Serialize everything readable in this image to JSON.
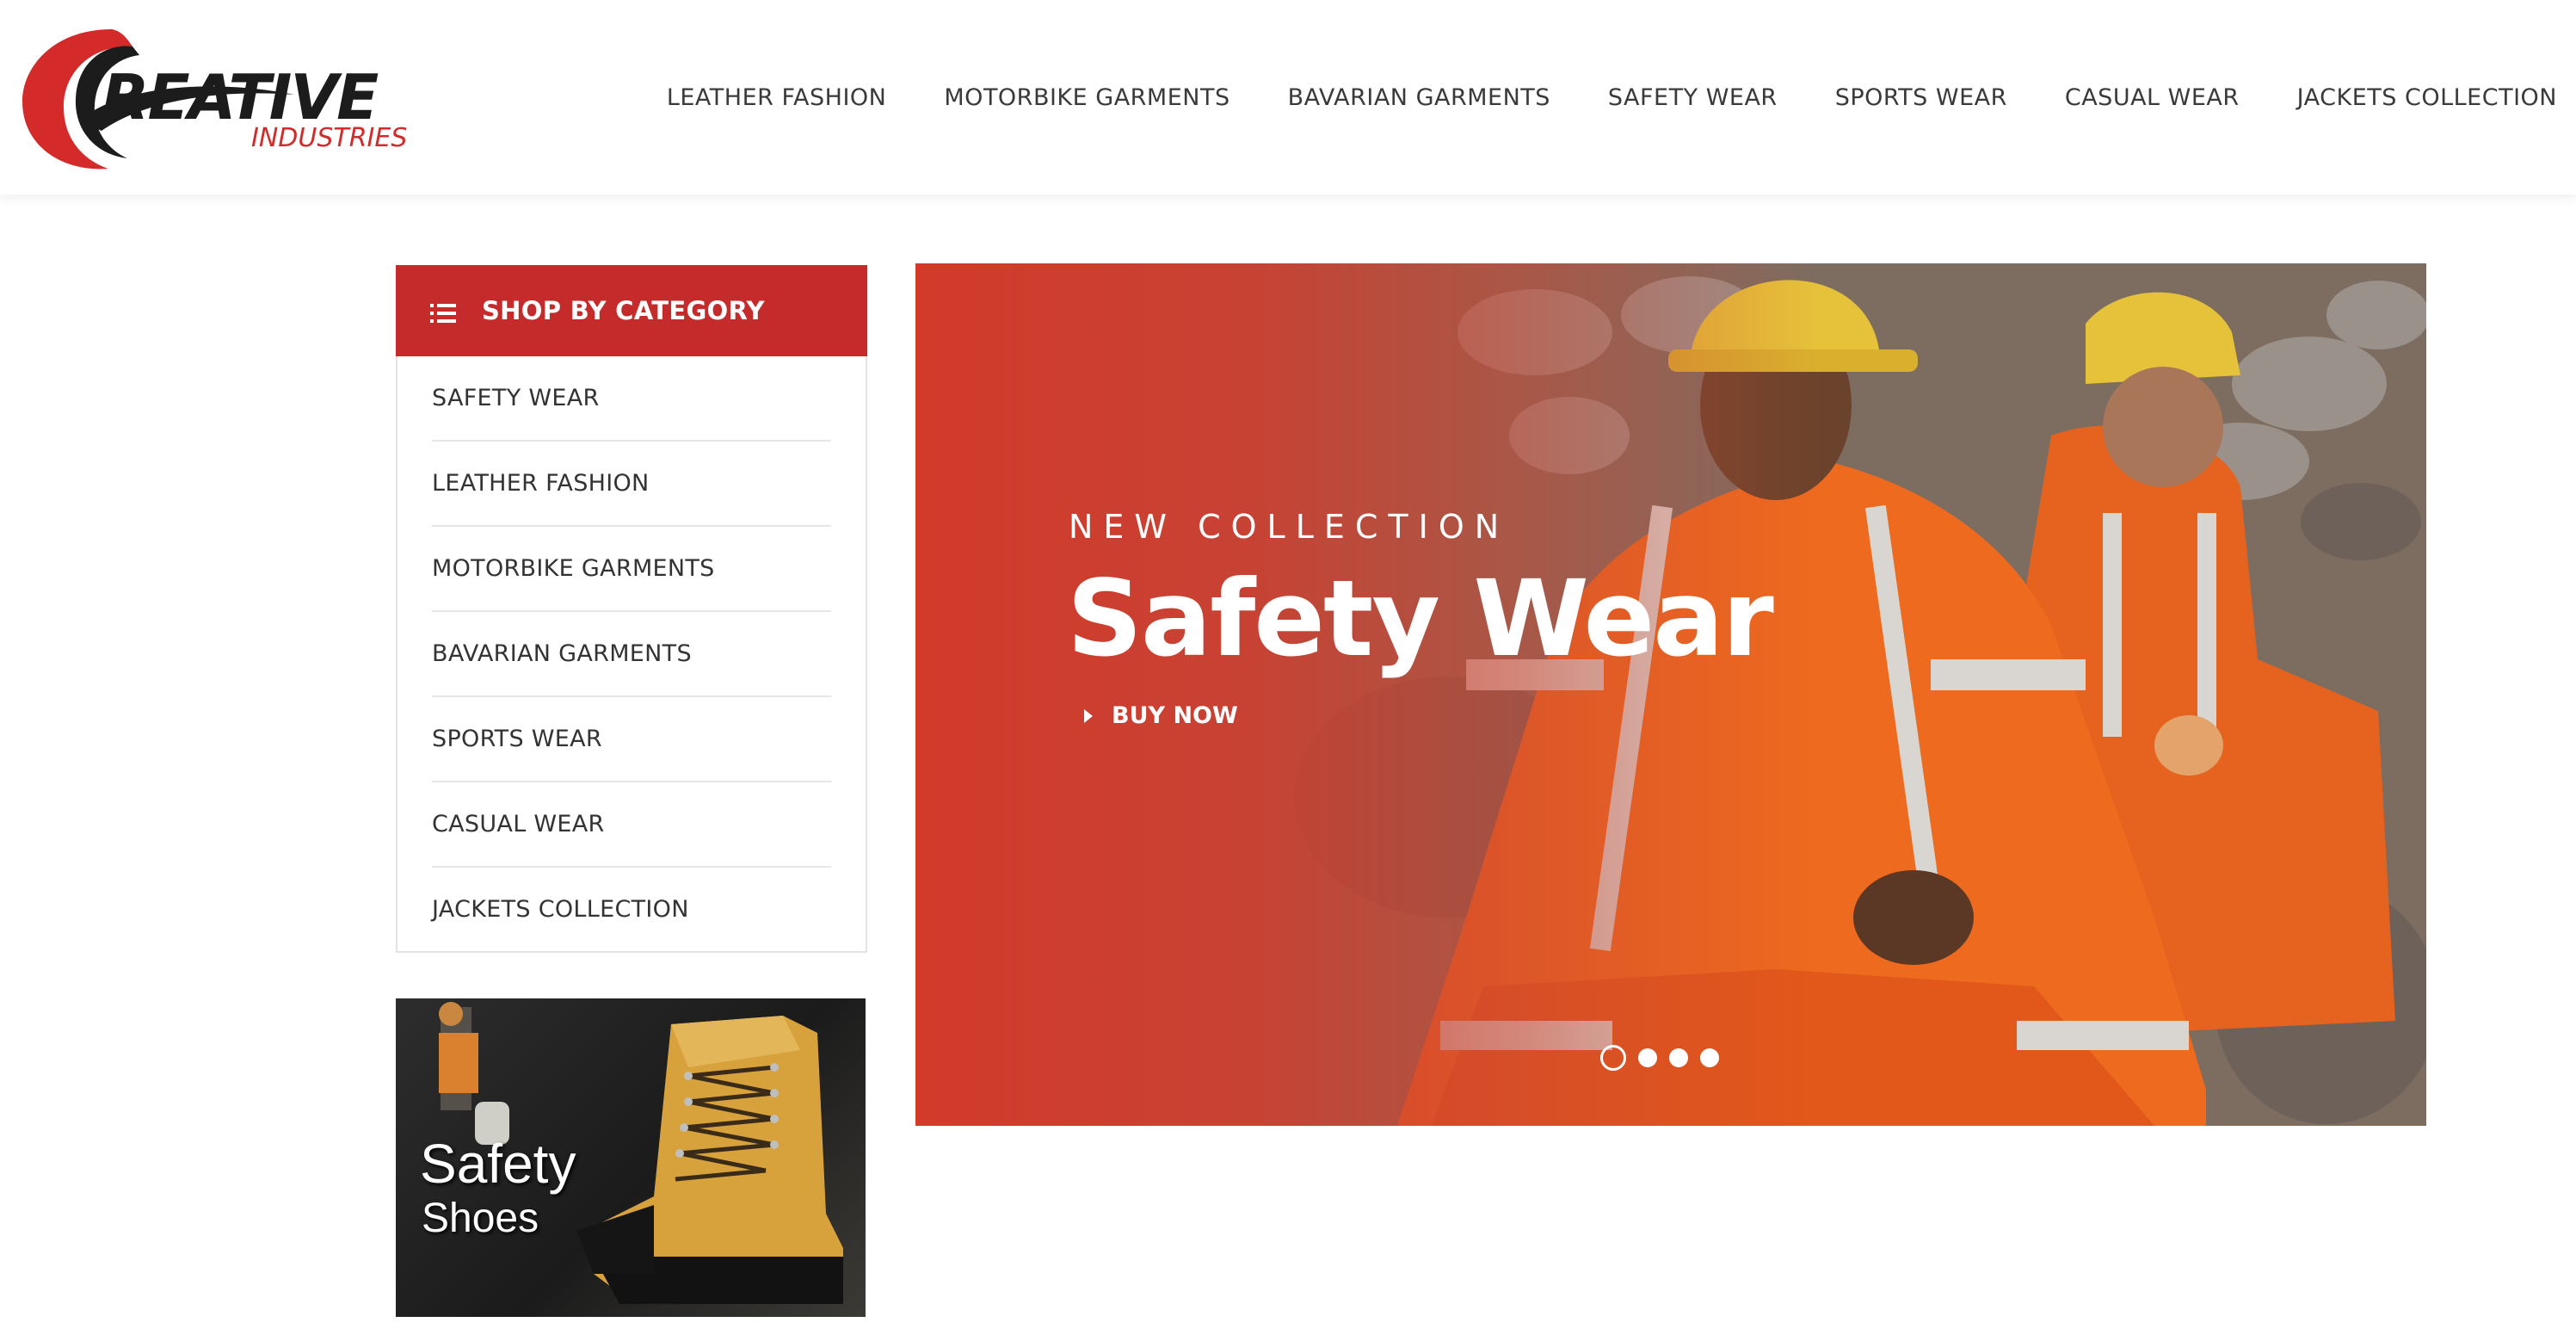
{
  "brand": {
    "logo_word": "REATIVE",
    "logo_sub": "INDUSTRIES",
    "colors": {
      "accent": "#c62b2b",
      "logo_red": "#d42a2a",
      "text": "#333333"
    }
  },
  "nav": {
    "items": [
      {
        "label": "LEATHER FASHION"
      },
      {
        "label": "MOTORBIKE GARMENTS"
      },
      {
        "label": "BAVARIAN GARMENTS"
      },
      {
        "label": "SAFETY WEAR"
      },
      {
        "label": "SPORTS WEAR"
      },
      {
        "label": "CASUAL WEAR"
      },
      {
        "label": "JACKETS COLLECTION"
      }
    ]
  },
  "sidebar": {
    "heading": "SHOP BY CATEGORY",
    "heading_icon": "list-icon",
    "categories": [
      {
        "label": "SAFETY WEAR"
      },
      {
        "label": "LEATHER FASHION"
      },
      {
        "label": "MOTORBIKE GARMENTS"
      },
      {
        "label": "BAVARIAN GARMENTS"
      },
      {
        "label": "SPORTS WEAR"
      },
      {
        "label": "CASUAL WEAR"
      },
      {
        "label": "JACKETS COLLECTION"
      }
    ]
  },
  "promo": {
    "title": "Safety",
    "subtitle": "Shoes"
  },
  "hero": {
    "eyebrow": "NEW COLLECTION",
    "title": "Safety Wear",
    "cta": "BUY NOW",
    "slides_total": 4,
    "active_slide": 1
  }
}
